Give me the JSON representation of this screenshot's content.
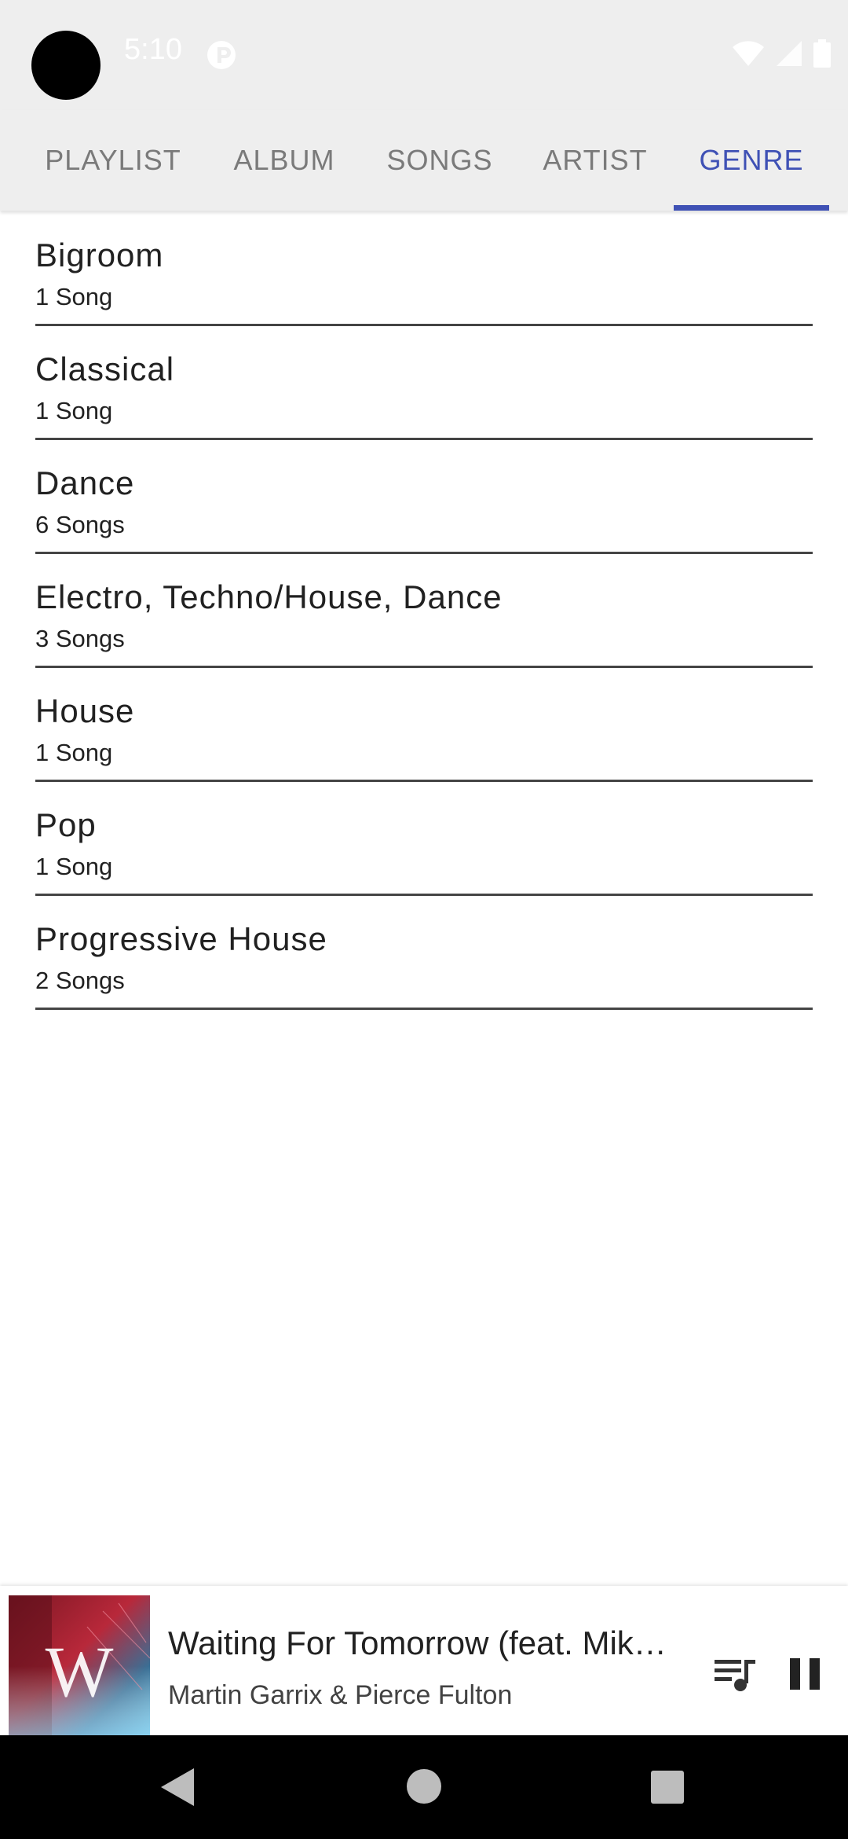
{
  "status_bar": {
    "time": "5:10",
    "icons": [
      "notification-icon",
      "wifi-icon",
      "signal-icon",
      "battery-icon"
    ]
  },
  "tabs": [
    {
      "label": "PLAYLIST",
      "active": false
    },
    {
      "label": "ALBUM",
      "active": false
    },
    {
      "label": "SONGS",
      "active": false
    },
    {
      "label": "ARTIST",
      "active": false
    },
    {
      "label": "GENRE",
      "active": true
    }
  ],
  "genres": [
    {
      "name": "Bigroom",
      "count": "1 Song"
    },
    {
      "name": "Classical",
      "count": "1 Song"
    },
    {
      "name": "Dance",
      "count": "6 Songs"
    },
    {
      "name": "Electro, Techno/House, Dance",
      "count": "3 Songs"
    },
    {
      "name": "House",
      "count": "1 Song"
    },
    {
      "name": "Pop",
      "count": "1 Song"
    },
    {
      "name": "Progressive House",
      "count": "2 Songs"
    }
  ],
  "mini_player": {
    "title": "Waiting For Tomorrow (feat. Mike Shinoda)",
    "artist": "Martin Garrix & Pierce Fulton",
    "album_art_letter": "W",
    "icons": [
      "queue-music-icon",
      "pause-icon"
    ]
  },
  "colors": {
    "accent": "#3f51b5",
    "tab_inactive": "#7a7a7a",
    "bar_background": "#eeeeee"
  }
}
